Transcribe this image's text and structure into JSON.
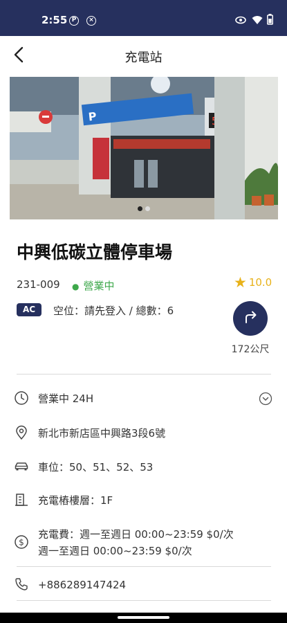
{
  "status_bar": {
    "time": "2:55",
    "icons": [
      "parking-icon",
      "cancel-icon",
      "eye-icon",
      "wifi-icon",
      "battery-icon"
    ]
  },
  "app_bar": {
    "title": "充電站",
    "back_icon": "back-arrow-icon"
  },
  "carousel": {
    "image": "parking-garage-entrance-photo",
    "page_count": 2,
    "current_page": 1
  },
  "station": {
    "name": "中興低碳立體停車場",
    "code": "231-009",
    "status": "營業中",
    "rating": "10.0",
    "charger_type": "AC",
    "parking": "空位：請先登入 / 總數：6",
    "distance": "172公尺"
  },
  "details": {
    "hours": "營業中 24H",
    "address": "新北市新店區中興路3段6號",
    "spaces": "車位：50、51、52、53",
    "floor": "充電樁樓層：1F",
    "fee_line1": "充電費：週一至週日 00:00~23:59 $0/次",
    "fee_line2": "週一至週日 00:00~23:59 $0/次",
    "phone": "+886289147424"
  },
  "colors": {
    "primary": "#26305e",
    "open_status": "#3ea84b",
    "rating": "#e8b21a"
  }
}
